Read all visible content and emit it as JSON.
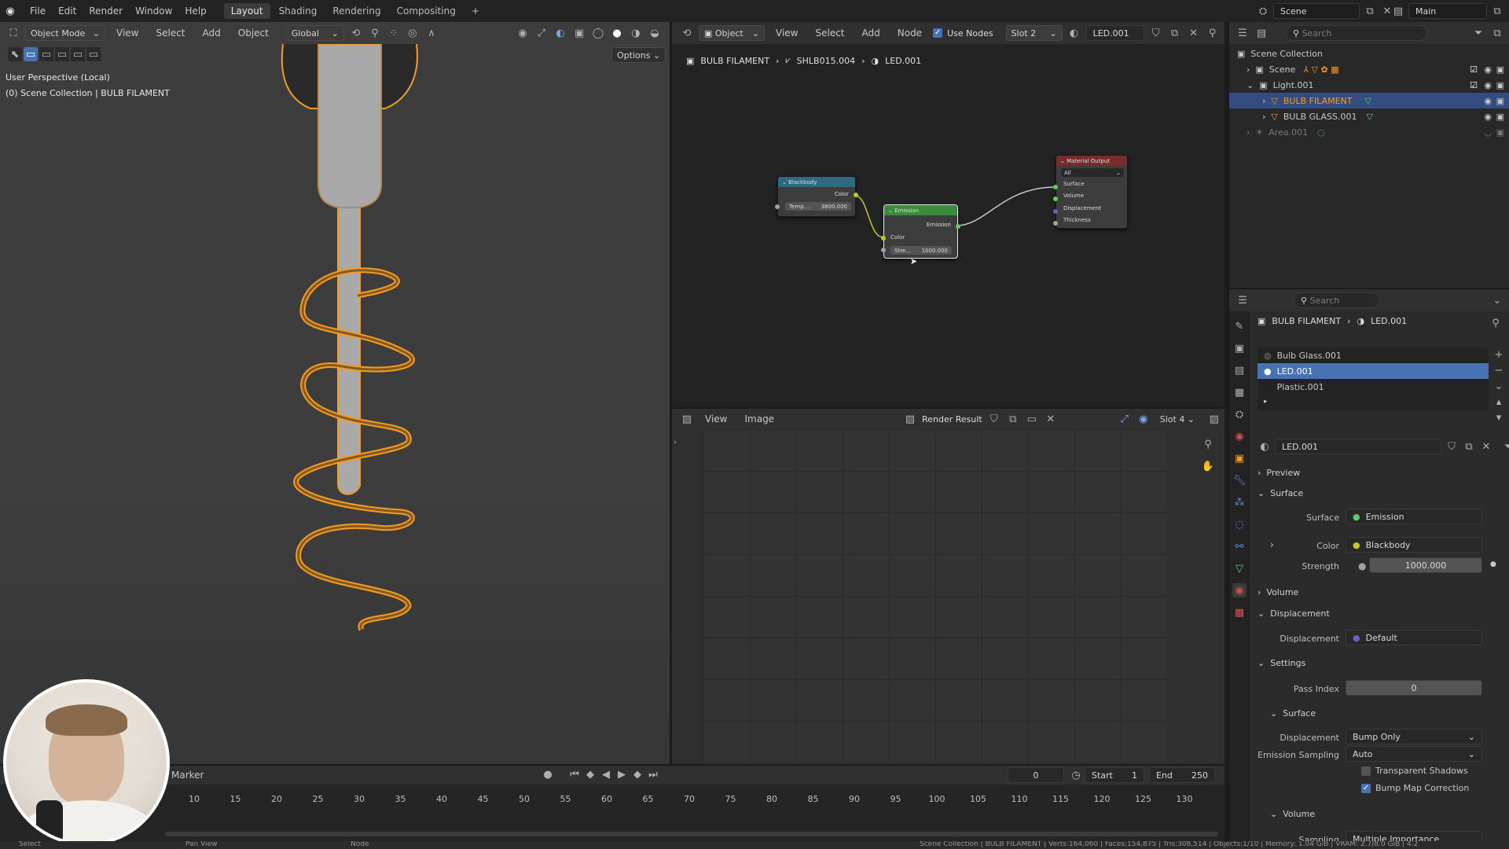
{
  "topbar": {
    "menus": [
      "File",
      "Edit",
      "Render",
      "Window",
      "Help"
    ],
    "workspaces": [
      "Layout",
      "Shading",
      "Rendering",
      "Compositing"
    ],
    "add_tab": "+",
    "scene_label": "Scene",
    "viewlayer_label": "Main"
  },
  "viewport": {
    "mode": "Object Mode",
    "menus": [
      "View",
      "Select",
      "Add",
      "Object"
    ],
    "orientation": "Global",
    "options": "Options",
    "info_line1": "User Perspective (Local)",
    "info_line2": "(0) Scene Collection | BULB FILAMENT"
  },
  "node_editor": {
    "type": "Object",
    "menus": [
      "View",
      "Select",
      "Add",
      "Node"
    ],
    "use_nodes": "Use Nodes",
    "slot": "Slot 2",
    "material": "LED.001",
    "breadcrumb": [
      "BULB FILAMENT",
      "SHLB015.004",
      "LED.001"
    ],
    "nodes": {
      "blackbody": {
        "title": "Blackbody",
        "out": "Color",
        "field": "Temp...",
        "value": "3800.000"
      },
      "emission": {
        "title": "Emission",
        "out": "Emission",
        "in": "Color",
        "field": "Stre...",
        "value": "1000.000"
      },
      "output": {
        "title": "Material Output",
        "target": "All",
        "inputs": [
          "Surface",
          "Volume",
          "Displacement",
          "Thickness"
        ]
      }
    }
  },
  "image_editor": {
    "menus": [
      "View",
      "Image"
    ],
    "image": "Render Result",
    "slot": "Slot 4"
  },
  "timeline": {
    "marker": "Marker",
    "frame": "0",
    "start_label": "Start",
    "start": "1",
    "end_label": "End",
    "end": "250",
    "ticks": [
      "10",
      "15",
      "20",
      "25",
      "30",
      "35",
      "40",
      "45",
      "50",
      "55",
      "60",
      "65",
      "70",
      "75",
      "80",
      "85",
      "90",
      "95",
      "100",
      "105",
      "110",
      "115",
      "120",
      "125",
      "130"
    ]
  },
  "outliner": {
    "search_placeholder": "Search",
    "root": "Scene Collection",
    "rows": [
      {
        "label": "Scene",
        "indent": 1
      },
      {
        "label": "Light.001",
        "indent": 1
      },
      {
        "label": "BULB FILAMENT",
        "indent": 2
      },
      {
        "label": "BULB GLASS.001",
        "indent": 2
      },
      {
        "label": "Area.001",
        "indent": 1
      }
    ]
  },
  "properties": {
    "search_placeholder": "Search",
    "breadcrumb_object": "BULB FILAMENT",
    "breadcrumb_material": "LED.001",
    "slots": [
      "Bulb Glass.001",
      "LED.001",
      "Plastic.001"
    ],
    "material_name": "LED.001",
    "preview": "Preview",
    "surface_panel": "Surface",
    "surface_label": "Surface",
    "surface_value": "Emission",
    "color_label": "Color",
    "color_value": "Blackbody",
    "strength_label": "Strength",
    "strength_value": "1000.000",
    "volume_panel": "Volume",
    "displacement_panel": "Displacement",
    "displacement_label": "Displacement",
    "displacement_value": "Default",
    "settings_panel": "Settings",
    "pass_index_label": "Pass Index",
    "pass_index_value": "0",
    "sub_surface": "Surface",
    "disp_method_label": "Displacement",
    "disp_method_value": "Bump Only",
    "emission_sampling_label": "Emission Sampling",
    "emission_sampling_value": "Auto",
    "transparent_shadows": "Transparent Shadows",
    "bump_map_correction": "Bump Map Correction",
    "sub_volume": "Volume",
    "sampling_label": "Sampling",
    "sampling_value": "Multiple Importance"
  },
  "statusbar": {
    "left": [
      "Select",
      "Pan View",
      "Node"
    ],
    "right": "Scene Collection | BULB FILAMENT | Verts:164,060 | Faces:154,875 | Tris:308,514 | Objects:1/10 | Memory: 1.04 GiB | VRAM: 2.7/8.0 GiB | 4.2"
  },
  "colors": {
    "accent": "#4772b3",
    "selected_outline": "#f19b28",
    "blackbody_header": "#2f6a82",
    "emission_header": "#3c8a3c",
    "output_header": "#7a2b2b"
  }
}
